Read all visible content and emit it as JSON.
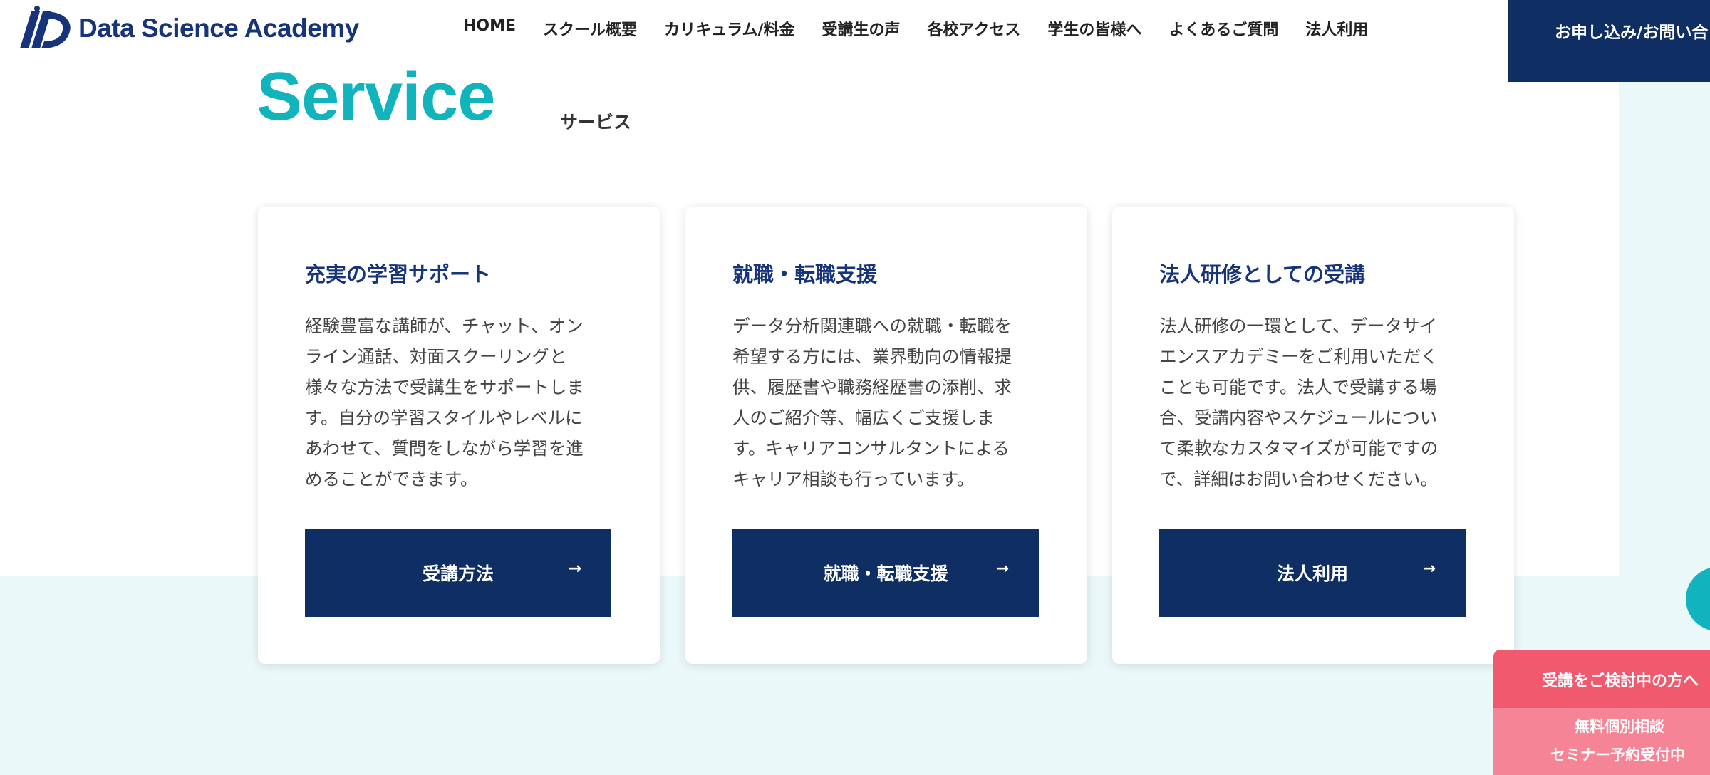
{
  "brand": {
    "name": "Data Science Academy",
    "logo_icon": "ds-logo-icon",
    "color": "#17337a"
  },
  "nav": {
    "items": [
      "HOME",
      "スクール概要",
      "カリキュラム/料金",
      "受講生の声",
      "各校アクセス",
      "学生の皆様へ",
      "よくあるご質問",
      "法人利用"
    ],
    "cta_label": "お申し込み/お問い合"
  },
  "section": {
    "title": "Service",
    "subtitle": "サービス",
    "accent": "#11b3bd"
  },
  "cards": [
    {
      "title": "充実の学習サポート",
      "lines": [
        "経験豊富な講師が、チャット、オン",
        "ライン通話、対面スクーリングと",
        "様々な方法で受講生をサポートしま",
        "す。自分の学習スタイルやレベルに",
        "あわせて、質問をしながら学習を進",
        "めることができます。"
      ],
      "button": "受講方法",
      "arrow": "→"
    },
    {
      "title": "就職・転職支援",
      "lines": [
        "データ分析関連職への就職・転職を",
        "希望する方には、業界動向の情報提",
        "供、履歴書や職務経歴書の添削、求",
        "人のご紹介等、幅広くご支援しま",
        "す。キャリアコンサルタントによる",
        "キャリア相談も行っています。"
      ],
      "button": "就職・転職支援",
      "arrow": "→"
    },
    {
      "title": "法人研修としての受講",
      "lines": [
        "法人研修の一環として、データサイ",
        "エンスアカデミーをご利用いただく",
        "ことも可能です。法人で受講する場",
        "合、受講内容やスケジュールについ",
        "て柔軟なカスタマイズが可能ですの",
        "で、詳細はお問い合わせください。"
      ],
      "button": "法人利用",
      "arrow": "→"
    }
  ],
  "side_panel": {
    "heading": "受講をご検討中の方へ",
    "line1": "無料個別相談",
    "line2": "セミナー予約受付中"
  },
  "colors": {
    "navy": "#0f2e63",
    "teal": "#11b3bd",
    "pale": "#eaf8f9",
    "pink": "#f0596e",
    "pink_light": "#f48496"
  }
}
